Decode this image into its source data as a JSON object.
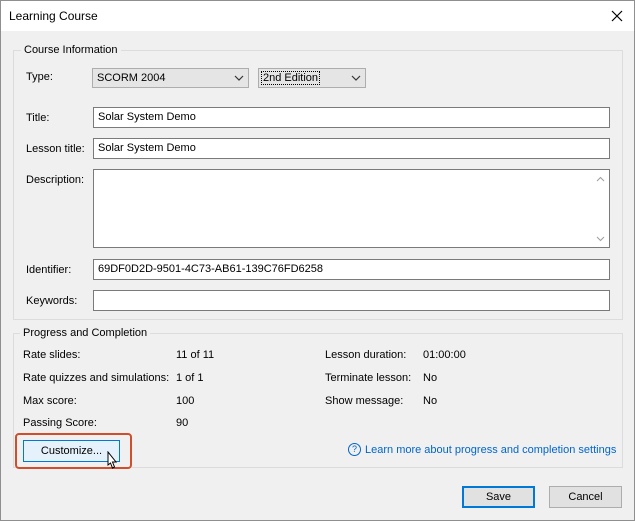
{
  "window": {
    "title": "Learning Course"
  },
  "course_info": {
    "legend": "Course Information",
    "type_label": "Type:",
    "type_value": "SCORM 2004",
    "edition_value": "2nd Edition",
    "title_label": "Title:",
    "title_value": "Solar System Demo",
    "lesson_title_label": "Lesson title:",
    "lesson_title_value": "Solar System Demo",
    "description_label": "Description:",
    "description_value": "",
    "identifier_label": "Identifier:",
    "identifier_value": "69DF0D2D-9501-4C73-AB61-139C76FD6258",
    "keywords_label": "Keywords:",
    "keywords_value": ""
  },
  "progress": {
    "legend": "Progress and Completion",
    "rate_slides_label": "Rate slides:",
    "rate_slides_value": "11 of 11",
    "rate_quizzes_label": "Rate quizzes and simulations:",
    "rate_quizzes_value": "1 of 1",
    "max_score_label": "Max score:",
    "max_score_value": "100",
    "passing_score_label": "Passing Score:",
    "passing_score_value": "90",
    "lesson_duration_label": "Lesson duration:",
    "lesson_duration_value": "01:00:00",
    "terminate_label": "Terminate lesson:",
    "terminate_value": "No",
    "show_message_label": "Show message:",
    "show_message_value": "No",
    "customize_label": "Customize...",
    "learn_more_label": "Learn more about progress and completion settings"
  },
  "footer": {
    "save_label": "Save",
    "cancel_label": "Cancel"
  },
  "colors": {
    "accent": "#0078d7",
    "highlight": "#d04e2c",
    "link": "#0066cc"
  },
  "icons": {
    "close": "close-icon",
    "dropdown": "chevron-down-icon",
    "help": "help-icon",
    "cursor": "mouse-cursor-icon"
  }
}
